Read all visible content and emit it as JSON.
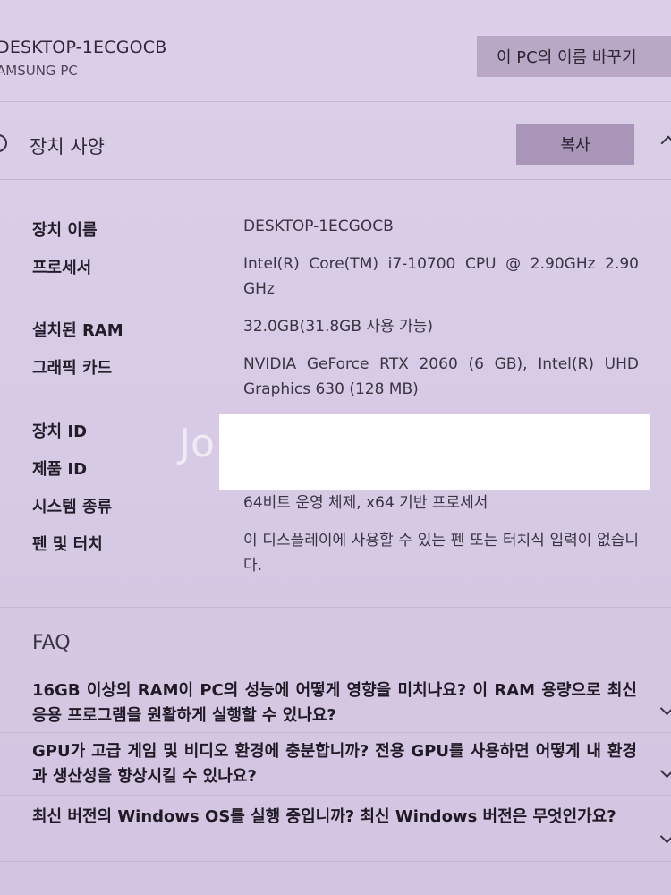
{
  "device": {
    "name": "DESKTOP-1ECGOCB",
    "model": "AMSUNG PC",
    "rename_button": "이 PC의 이름 바꾸기"
  },
  "specs_section": {
    "title": "장치 사양",
    "copy_button": "복사",
    "rows": [
      {
        "label": "장치 이름",
        "value": "DESKTOP-1ECGOCB"
      },
      {
        "label": "프로세서",
        "value": "Intel(R) Core(TM) i7-10700 CPU @ 2.90GHz 2.90 GHz"
      },
      {
        "label": "설치된 RAM",
        "value": "32.0GB(31.8GB 사용 가능)"
      },
      {
        "label": "그래픽 카드",
        "value": "NVIDIA GeForce RTX 2060 (6 GB), Intel(R) UHD Graphics 630 (128 MB)"
      },
      {
        "label": "장치 ID",
        "value": ""
      },
      {
        "label": "제품 ID",
        "value": ""
      },
      {
        "label": "시스템 종류",
        "value": "64비트 운영 체제, x64 기반 프로세서"
      },
      {
        "label": "펜 및 터치",
        "value": "이 디스플레이에 사용할 수 있는 펜 또는 터치식 입력이 없습니다."
      }
    ],
    "watermark": "Jo"
  },
  "faq": {
    "title": "FAQ",
    "items": [
      {
        "question": "16GB 이상의 RAM이 PC의 성능에 어떻게 영향을 미치나요? 이 RAM 용량으로 최신 응용 프로그램을 원활하게 실행할 수 있나요?"
      },
      {
        "question": "GPU가 고급 게임 및 비디오 환경에 충분합니까? 전용 GPU를 사용하면 어떻게 내 환경과 생산성을 향상시킬 수 있나요?"
      },
      {
        "question": "최신 버전의 Windows OS를 실행 중입니까? 최신 Windows 버전은 무엇인가요?"
      }
    ]
  },
  "colors": {
    "background": "#d9cde5",
    "rename_button": "#b8a8c6",
    "copy_button": "#a995b8"
  }
}
